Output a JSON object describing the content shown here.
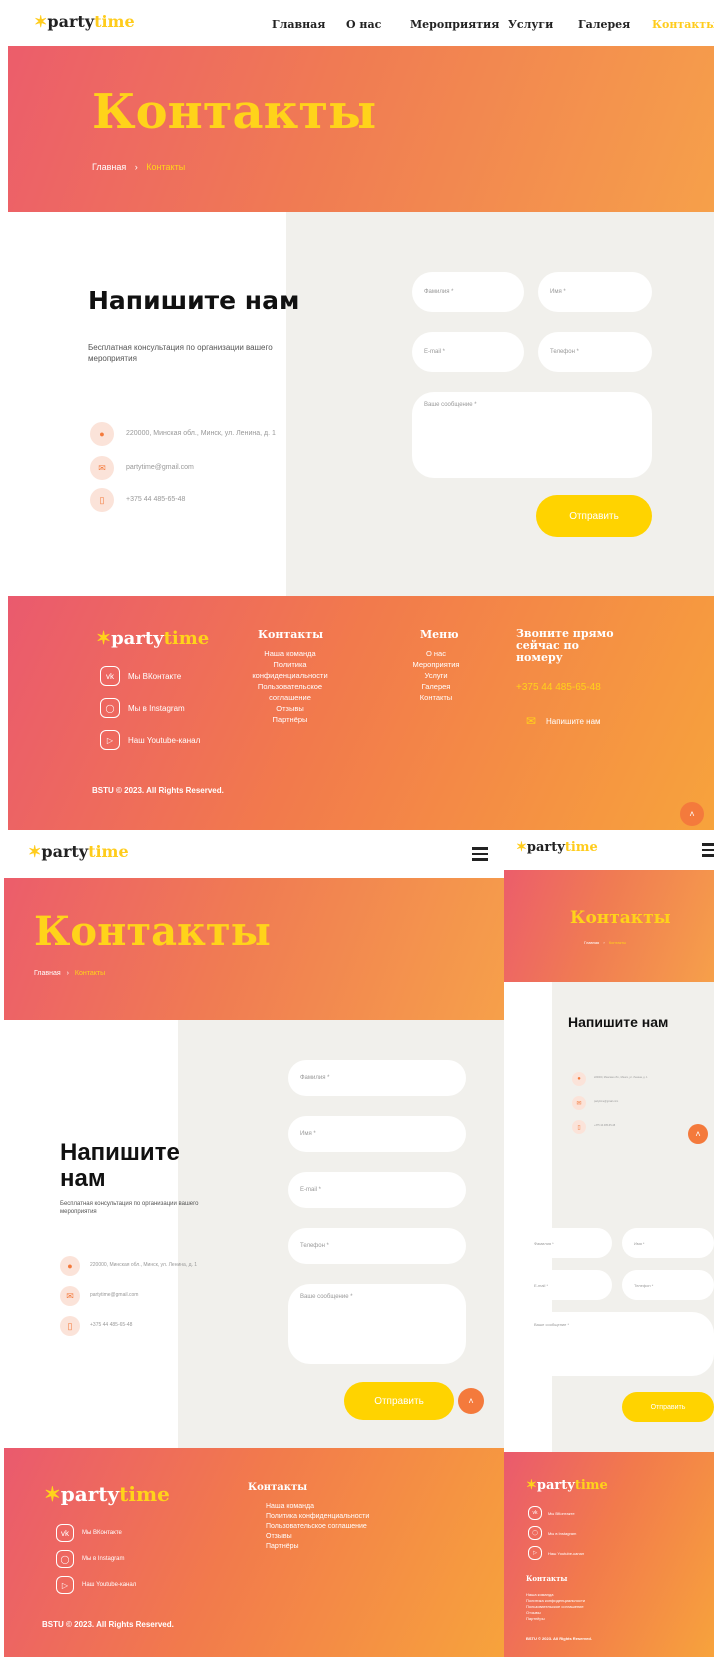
{
  "brand": {
    "logo_a": "party",
    "logo_b": "time"
  },
  "nav": {
    "items": [
      "Главная",
      "О нас",
      "Мероприятия",
      "Услуги",
      "Галерея",
      "Контакты"
    ]
  },
  "hero": {
    "title": "Контакты",
    "crumb_home": "Главная",
    "crumb_sep": "›",
    "crumb_current": "Контакты"
  },
  "contact": {
    "heading": "Напишите нам",
    "heading_l1": "Напишите",
    "heading_l2": "нам",
    "subtitle": "Бесплатная консультация по организации вашего мероприятия",
    "address": "220000, Минская обл., Минск, ул. Ленина, д. 1",
    "email": "partytime@gmail.com",
    "phone": "+375 44 485-65-48"
  },
  "form": {
    "surname": "Фамилия *",
    "name": "Имя *",
    "email": "E-mail *",
    "phone": "Телефон *",
    "message": "Ваше сообщение *",
    "submit": "Отправить"
  },
  "footer": {
    "social": [
      "Мы ВКонтакте",
      "Мы в Instagram",
      "Наш Youtube-канал"
    ],
    "contacts_title": "Контакты",
    "contacts_links": [
      "Наша команда",
      "Политика конфиденциальности",
      "Пользовательское соглашение",
      "Отзывы",
      "Партнёры"
    ],
    "menu_title": "Меню",
    "menu_links": [
      "О нас",
      "Мероприятия",
      "Услуги",
      "Галерея",
      "Контакты"
    ],
    "call_title": "Звоните прямо сейчас по номеру",
    "call_phone": "+375 44 485-65-48",
    "write_us": "Напишите нам",
    "copyright": "BSTU © 2023. All Rights Reserved."
  },
  "icons": {
    "location": "location-icon",
    "mail": "mail-icon",
    "phone": "phone-icon",
    "vk": "vk-icon",
    "instagram": "instagram-icon",
    "youtube": "youtube-icon",
    "arrow_up": "arrow-up-icon",
    "menu": "hamburger-icon"
  },
  "colors": {
    "accent_yellow": "#ffd300",
    "accent_orange": "#f47a3c",
    "gradient_start": "#ea5a6e",
    "gradient_end": "#f7a33c"
  }
}
